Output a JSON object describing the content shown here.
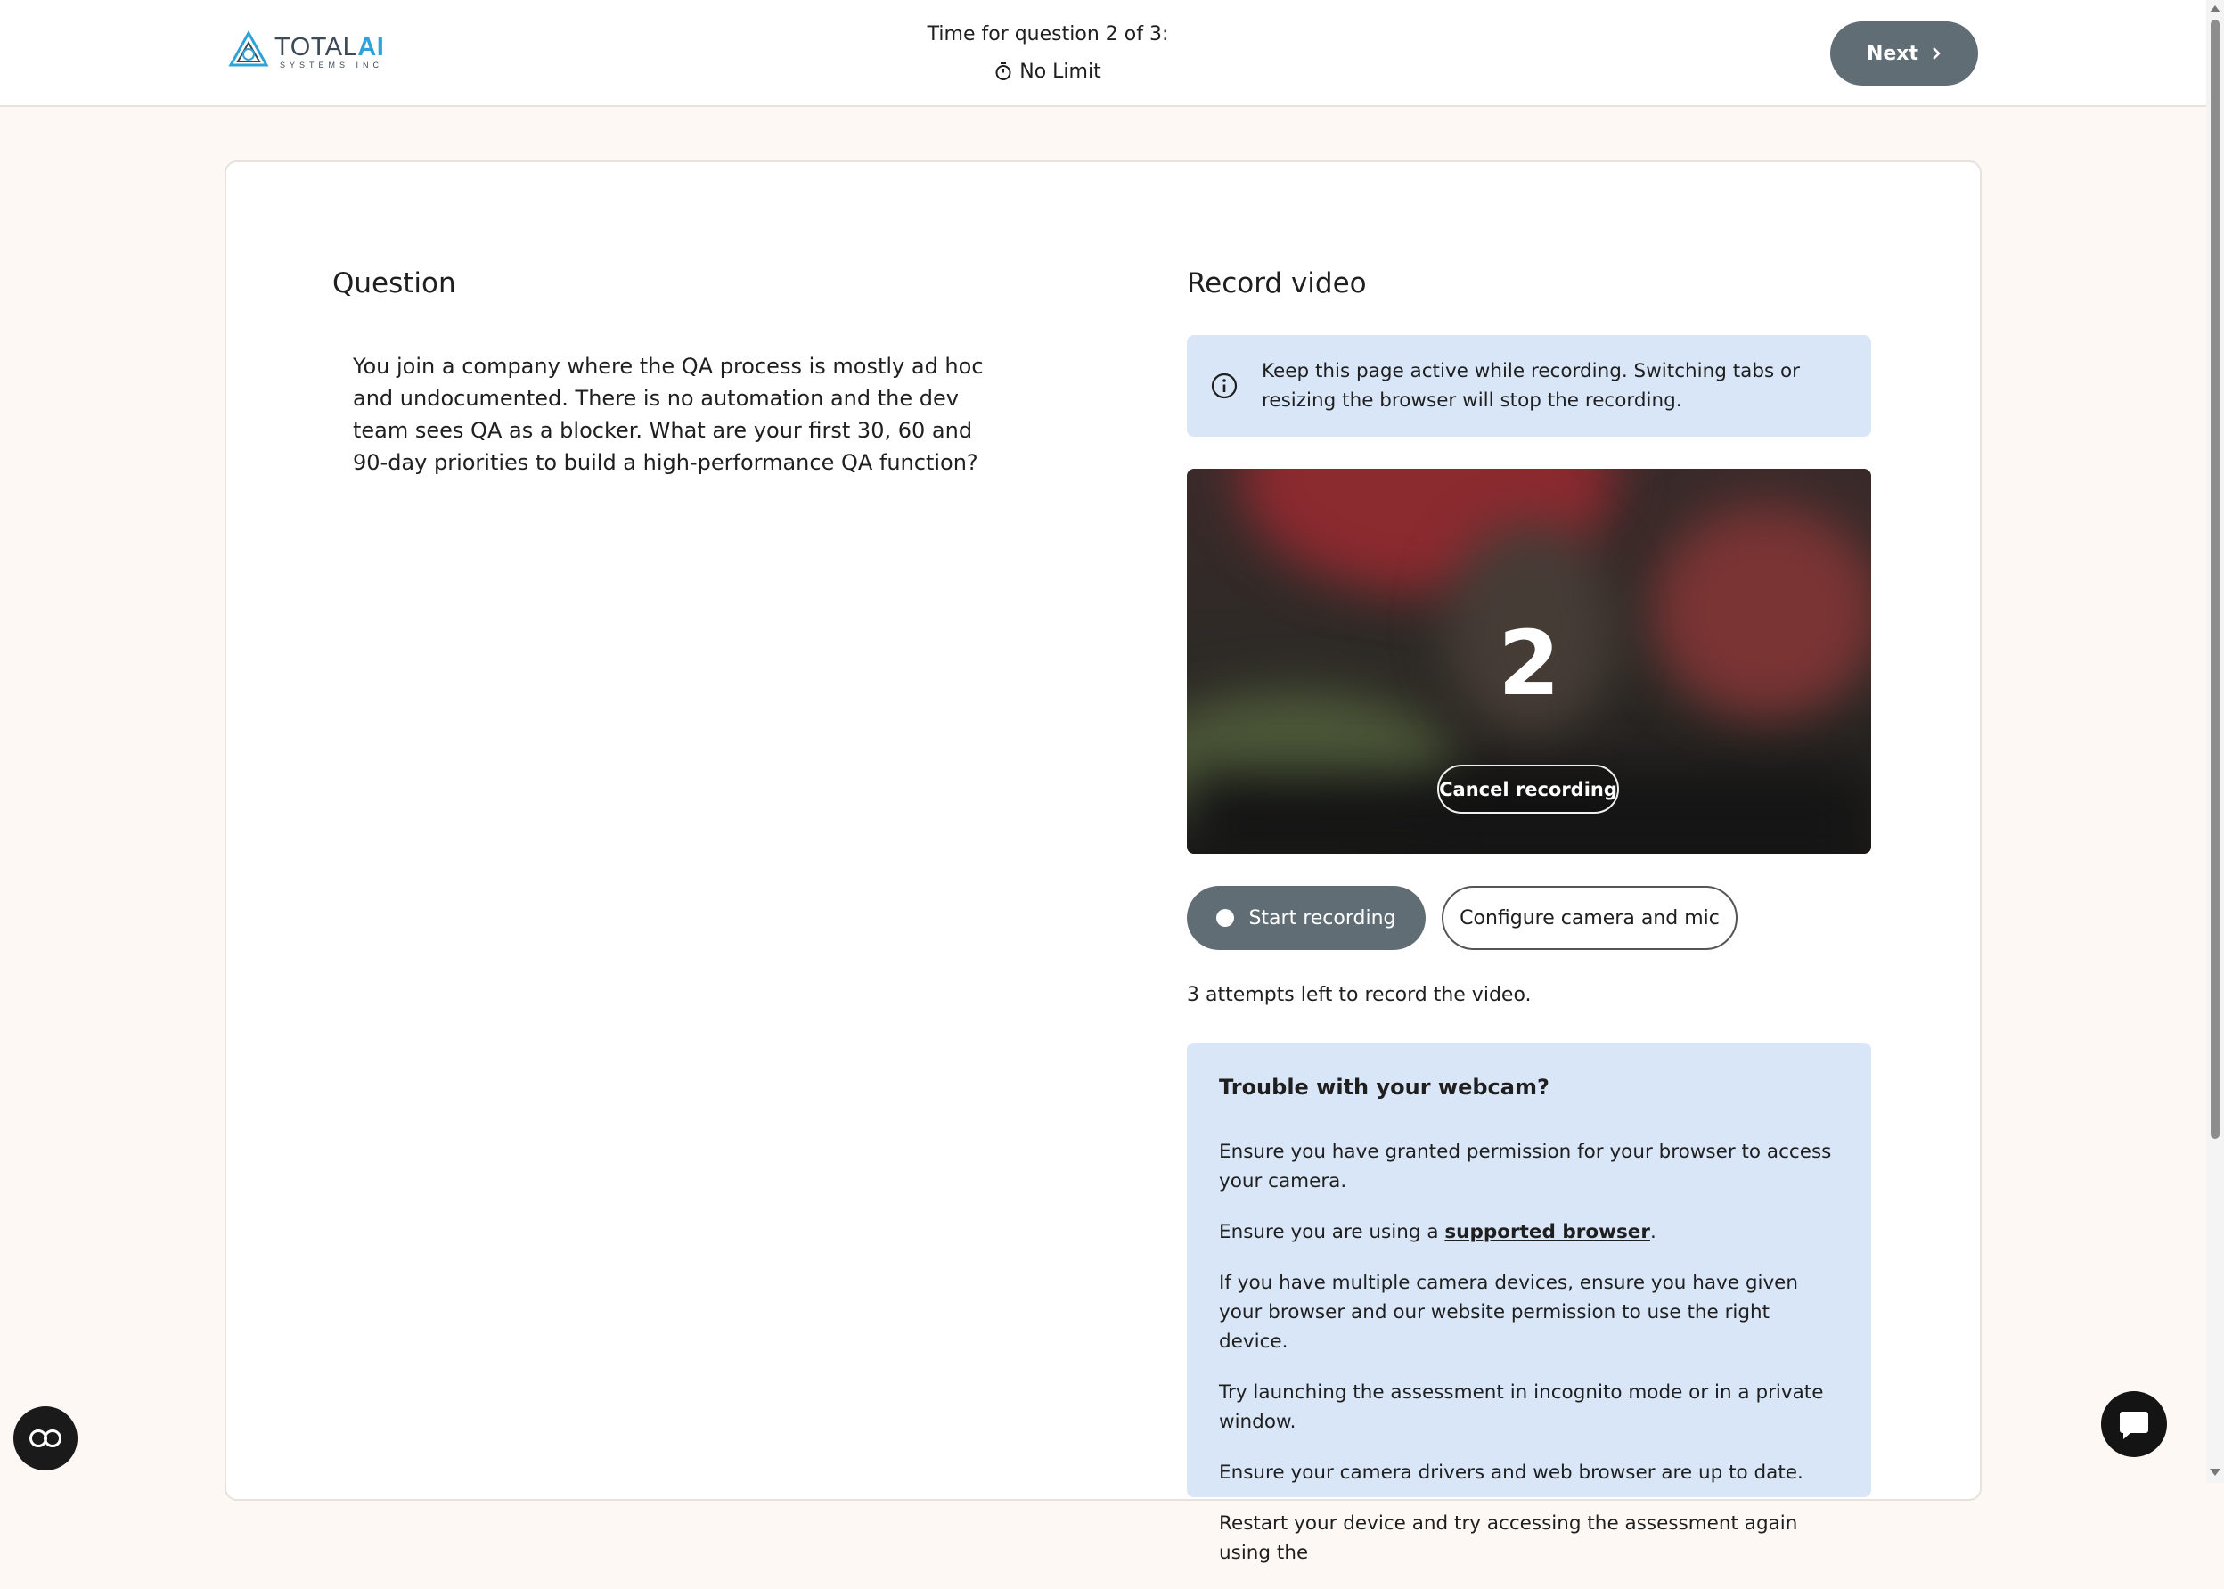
{
  "header": {
    "logo": {
      "word_total": "TOTAL",
      "word_ai": "AI",
      "sub": "SYSTEMS INC"
    },
    "timer_title": "Time for question 2 of 3:",
    "timer_value": "No Limit",
    "next_label": "Next"
  },
  "question": {
    "heading": "Question",
    "text": "You join a company where the QA process is mostly ad hoc and undocumented. There is no automation and the dev team sees QA as a blocker. What are your first 30, 60 and 90-day priorities to build a high-performance QA function?"
  },
  "record": {
    "heading": "Record video",
    "notice": "Keep this page active while recording. Switching tabs or resizing the browser will stop the recording.",
    "countdown": "2",
    "cancel_label": "Cancel recording",
    "start_label": "Start recording",
    "config_label": "Configure camera and mic",
    "attempts": "3 attempts left to record the video."
  },
  "trouble": {
    "title": "Trouble with your webcam?",
    "tip1": "Ensure you have granted permission for your browser to access your camera.",
    "tip2_prefix": "Ensure you are using a ",
    "tip2_link": "supported browser",
    "tip2_suffix": ".",
    "tip3": "If you have multiple camera devices, ensure you have given your browser and our website permission to use the right device.",
    "tip4": "Try launching the assessment in incognito mode or in a private window.",
    "tip5": "Ensure your camera drivers and web browser are up to date.",
    "tip6": "Restart your device and try accessing the assessment again using the"
  },
  "colors": {
    "button_dark": "#616d75",
    "info_bg": "#d8e6f8",
    "page_bg": "#fdf8f4",
    "logo_accent": "#2fa3d6"
  },
  "icons": [
    "logo-icon",
    "stopwatch-icon",
    "chevron-right-icon",
    "info-icon",
    "record-dot-icon",
    "accessibility-icon",
    "chat-icon"
  ]
}
